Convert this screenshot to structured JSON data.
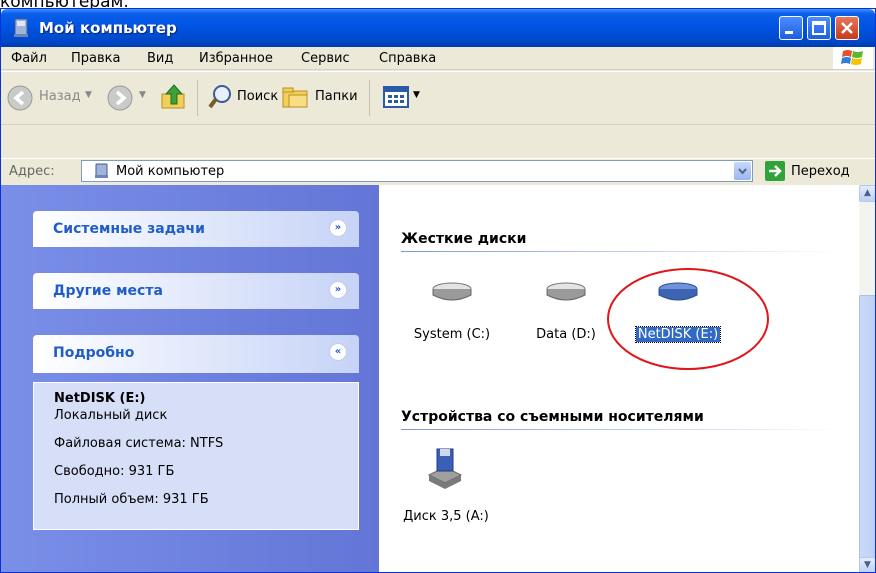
{
  "window": {
    "title": "Мой компьютер"
  },
  "menu": [
    "Файл",
    "Правка",
    "Вид",
    "Избранное",
    "Сервис",
    "Справка"
  ],
  "toolbar": {
    "back": "Назад",
    "search": "Поиск",
    "folders": "Папки"
  },
  "address": {
    "label": "Адрес:",
    "value": "Мой компьютер",
    "go": "Переход"
  },
  "left": {
    "system_tasks": "Системные задачи",
    "other_places": "Другие места",
    "details": "Подробно",
    "details_lines": [
      "NetDISK (E:)",
      "Локальный диск",
      "Файловая система: NTFS",
      "Свободно: 931 ГБ",
      "Полный объем: 931 ГБ"
    ]
  },
  "groups": {
    "hard_drives": {
      "title": "Жесткие диски",
      "items": [
        {
          "label": "System (C:)",
          "icon": "hard-drive-icon"
        },
        {
          "label": "Data (D:)",
          "icon": "hard-drive-icon"
        },
        {
          "label": "NetDISK (E:)",
          "icon": "network-drive-icon",
          "selected": true
        }
      ]
    },
    "removable": {
      "title": "Устройства со съемными носителями",
      "items": [
        {
          "label": "Диск 3,5 (A:)",
          "icon": "floppy-drive-icon"
        }
      ]
    }
  },
  "colors": {
    "title_blue": "#0054e3",
    "selection": "#316ac5",
    "highlight_ellipse": "#e0161b",
    "task_pane": "#6375d6"
  }
}
